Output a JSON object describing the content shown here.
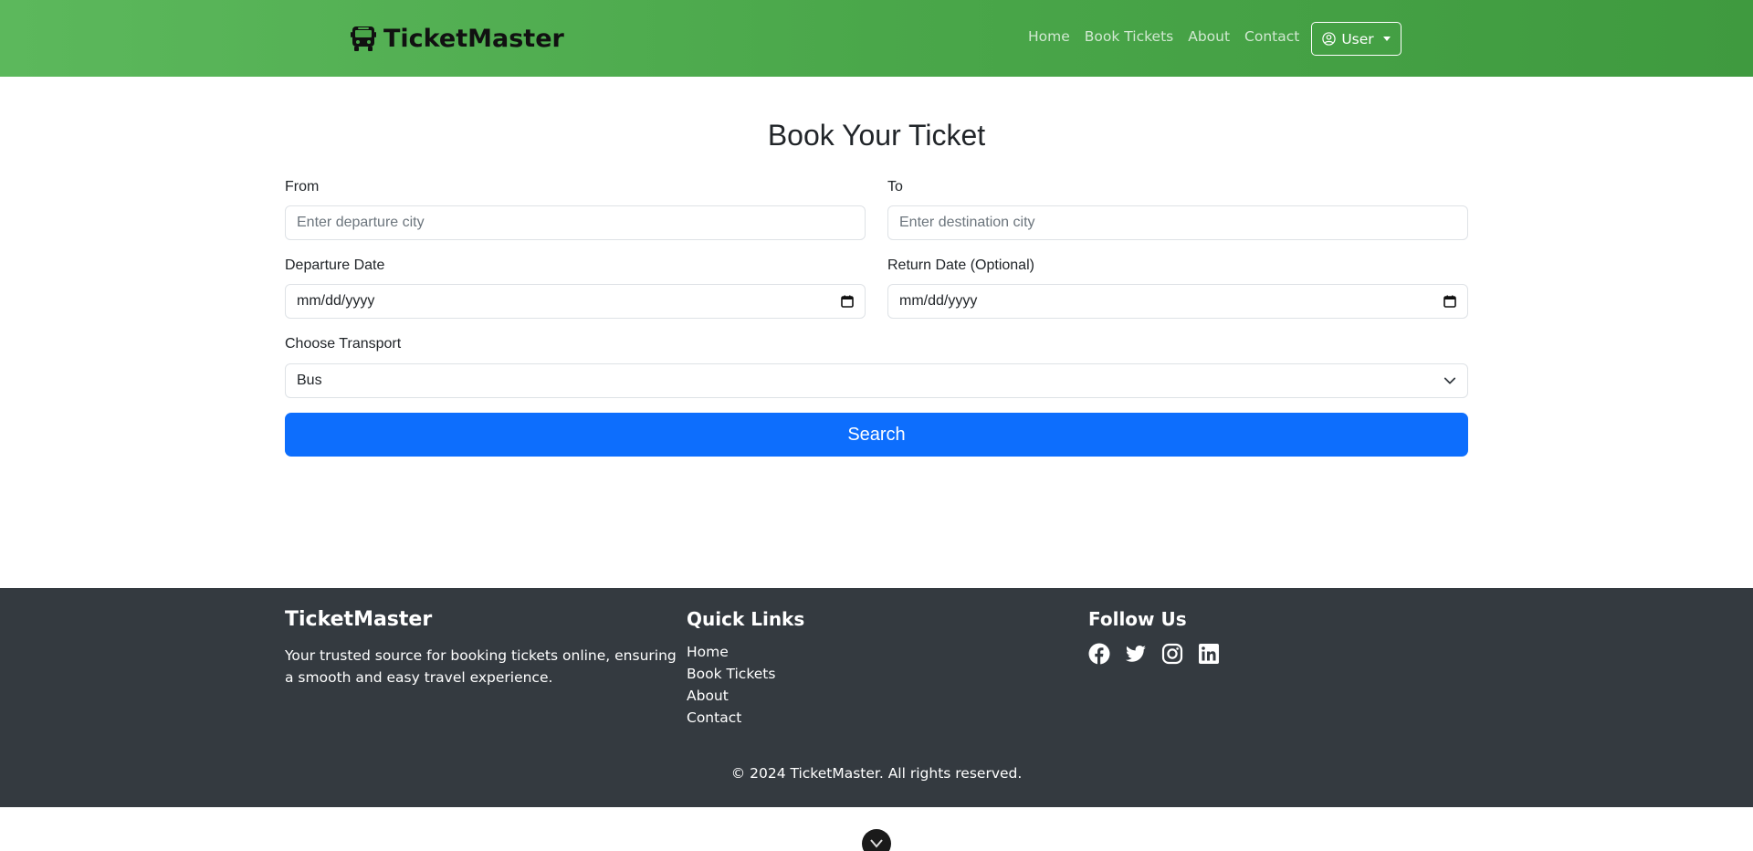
{
  "header": {
    "brand": "TicketMaster",
    "nav": [
      "Home",
      "Book Tickets",
      "About",
      "Contact"
    ],
    "user_label": "User"
  },
  "form": {
    "title": "Book Your Ticket",
    "from_label": "From",
    "from_placeholder": "Enter departure city",
    "to_label": "To",
    "to_placeholder": "Enter destination city",
    "departure_label": "Departure Date",
    "departure_value": "mm/dd/yyyy",
    "return_label": "Return Date (Optional)",
    "return_value": "mm/dd/yyyy",
    "transport_label": "Choose Transport",
    "transport_value": "Bus",
    "search_label": "Search"
  },
  "footer": {
    "brand": "TicketMaster",
    "about": "Your trusted source for booking tickets online, ensuring a smooth and easy travel experience.",
    "links_title": "Quick Links",
    "links": [
      "Home",
      "Book Tickets",
      "About",
      "Contact"
    ],
    "follow_title": "Follow Us",
    "social_icons": [
      "facebook-icon",
      "twitter-icon",
      "instagram-icon",
      "linkedin-icon"
    ],
    "copyright": "© 2024 TicketMaster. All rights reserved."
  },
  "colors": {
    "header_green": "#4aa74a",
    "primary_blue": "#0d6efd",
    "footer_dark": "#343a40"
  }
}
